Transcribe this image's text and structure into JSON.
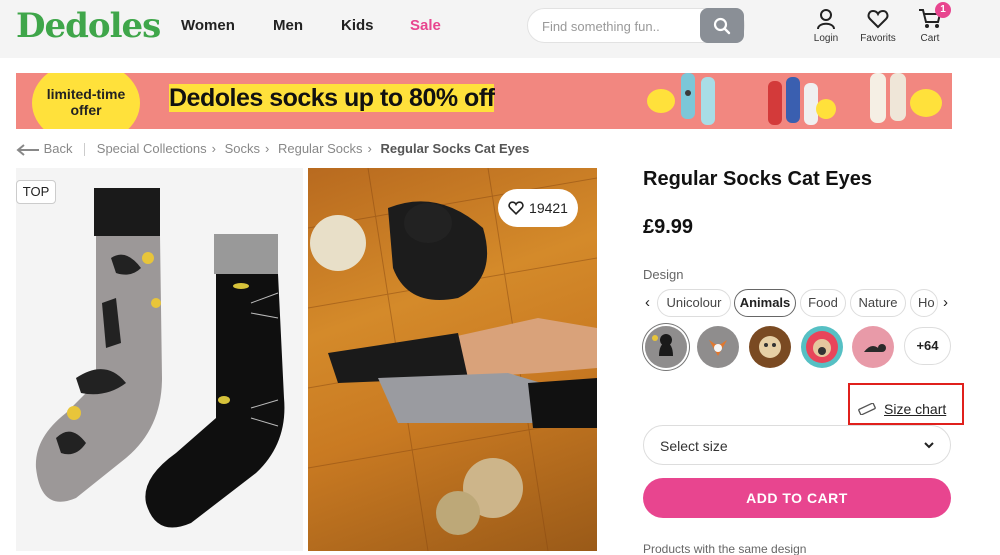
{
  "brand": {
    "logo": "Dedoles"
  },
  "nav": {
    "women": "Women",
    "men": "Men",
    "kids": "Kids",
    "sale": "Sale"
  },
  "search": {
    "placeholder": "Find something fun.."
  },
  "header_actions": {
    "login": "Login",
    "favorites": "Favorits",
    "cart": "Cart",
    "cart_count": "1"
  },
  "banner": {
    "badge": "limited-time offer",
    "title": "Dedoles socks up to 80% off"
  },
  "breadcrumb": {
    "back": "Back",
    "items": [
      "Special Collections",
      "Socks",
      "Regular Socks"
    ],
    "current": "Regular Socks Cat Eyes"
  },
  "gallery": {
    "tag": "TOP",
    "favorites_count": "19421"
  },
  "product": {
    "title": "Regular Socks Cat Eyes",
    "price": "£9.99",
    "design_label": "Design",
    "design_tabs": [
      "Unicolour",
      "Animals",
      "Food",
      "Nature",
      "Ho"
    ],
    "active_tab": "Animals",
    "more_designs": "+64",
    "size_chart": "Size chart",
    "size_select": "Select size",
    "add_to_cart": "ADD TO CART",
    "same_design": "Products with the same design"
  },
  "colors": {
    "brand_green": "#3fa64a",
    "accent_pink": "#e8458f",
    "banner_bg": "#f28780",
    "highlight_yellow": "#ffe13b",
    "annotation_red": "#e0201c"
  }
}
